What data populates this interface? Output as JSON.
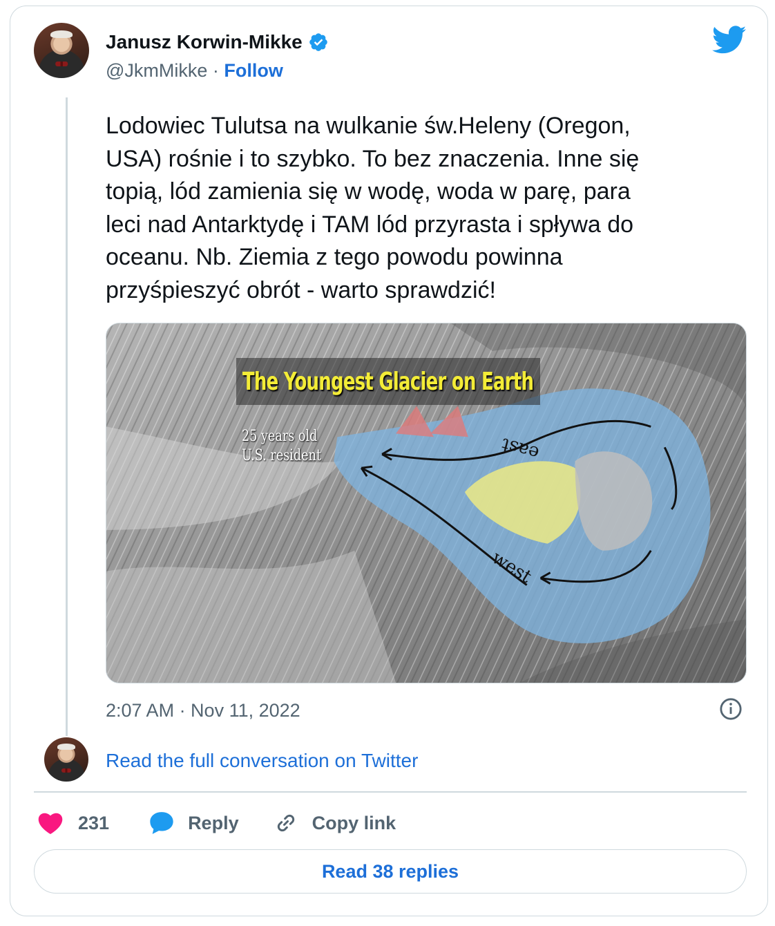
{
  "tweet": {
    "author_name": "Janusz Korwin-Mikke",
    "handle": "@JkmMikke",
    "separator": " · ",
    "follow_label": "Follow",
    "text": "Lodowiec Tulutsa na wulkanie św.Heleny (Oregon,\nUSA) rośnie i to szybko. To bez znaczenia. Inne się\ntopią, lód zamienia się w wodę, woda w parę, para\nleci nad Antarktydę i TAM lód przyrasta i spływa do\noceanu. Nb. Ziemia z tego powodu powinna\nprzyśpieszyć obrót - warto sprawdzić!",
    "timestamp": "2:07 AM · Nov 11, 2022"
  },
  "media": {
    "title": "The Youngest Glacier on Earth",
    "resident_label": "25 years old\nU.S. resident",
    "east_label": "east",
    "west_label": "west"
  },
  "conversation": {
    "read_full_label": "Read the full conversation on Twitter"
  },
  "actions": {
    "like_count": "231",
    "reply_label": "Reply",
    "copy_link_label": "Copy link"
  },
  "footer": {
    "read_replies_label": "Read 38 replies"
  },
  "icons": {
    "verified": "verified-badge-icon",
    "twitter": "twitter-bird-icon",
    "info": "info-icon",
    "heart": "heart-icon",
    "reply": "speech-bubble-icon",
    "link": "link-icon"
  },
  "colors": {
    "link_blue": "#1d6fd8",
    "twitter_blue": "#1d9bf0",
    "like_pink": "#f91880",
    "secondary_text": "#536471"
  }
}
